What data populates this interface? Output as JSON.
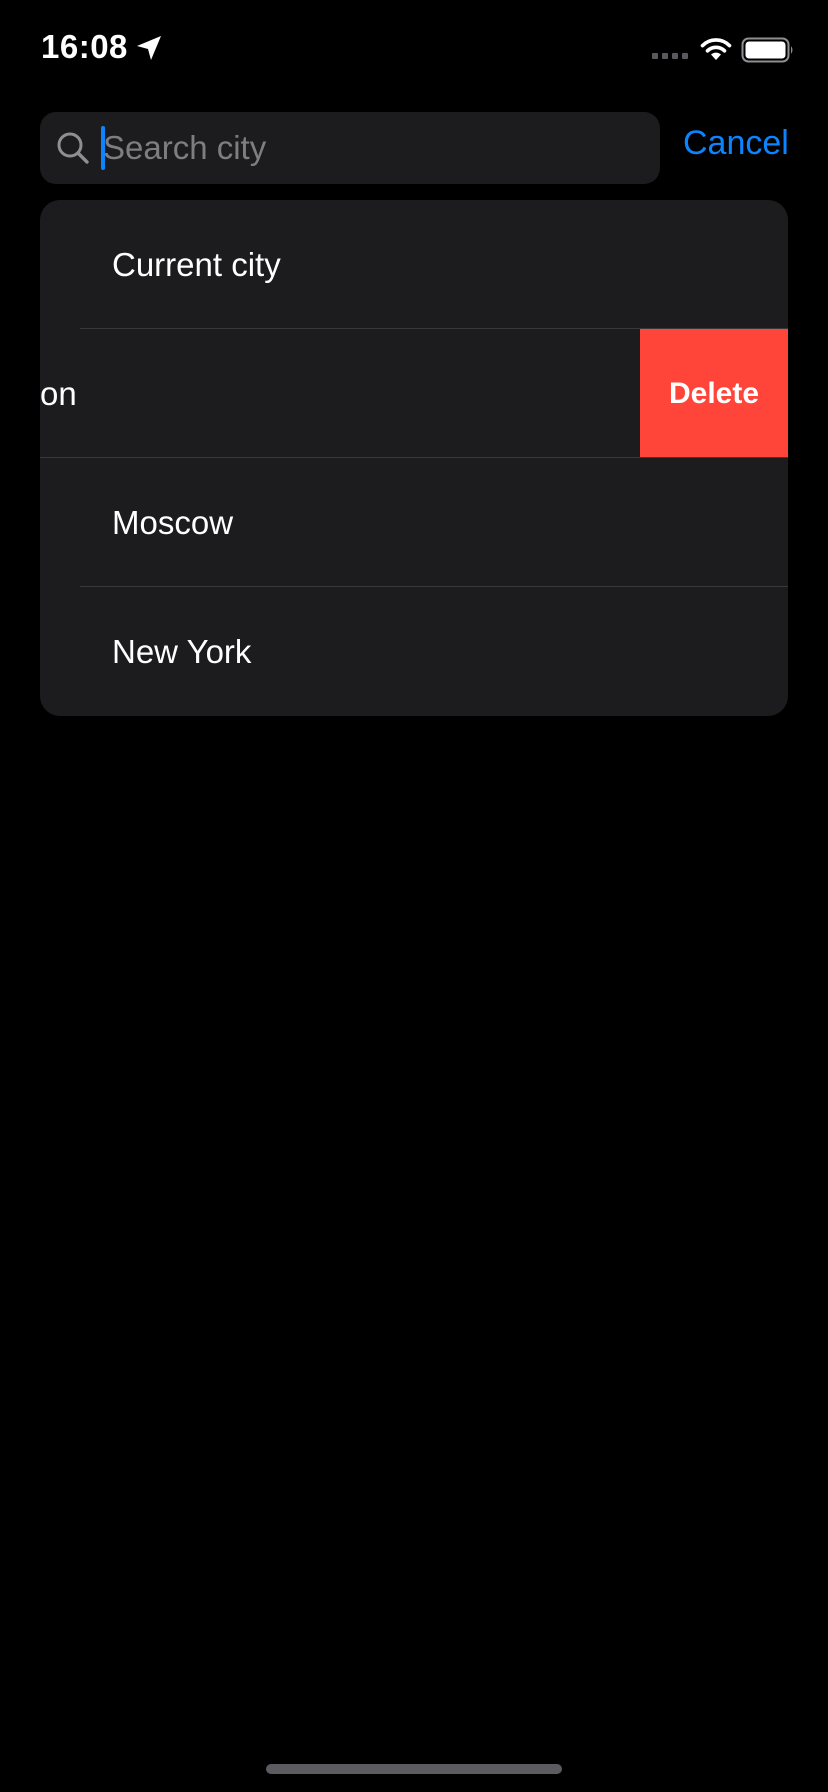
{
  "status_bar": {
    "time": "16:08",
    "icons": [
      "location-arrow-icon",
      "cellular-signal-icon",
      "wifi-icon",
      "battery-icon"
    ],
    "battery_level": 1.0
  },
  "search": {
    "placeholder": "Search city",
    "value": "",
    "icon": "search-icon",
    "cancel_label": "Cancel"
  },
  "city_list": {
    "items": [
      {
        "label": "Current city"
      },
      {
        "label": "on",
        "swiped": true,
        "action_label": "Delete"
      },
      {
        "label": "Moscow"
      },
      {
        "label": "New York"
      }
    ]
  },
  "colors": {
    "background": "#000000",
    "cell_background": "#1c1c1e",
    "accent": "#0a84ff",
    "destructive": "#ff453a",
    "separator": "#38383a",
    "placeholder": "#7d7d82"
  }
}
